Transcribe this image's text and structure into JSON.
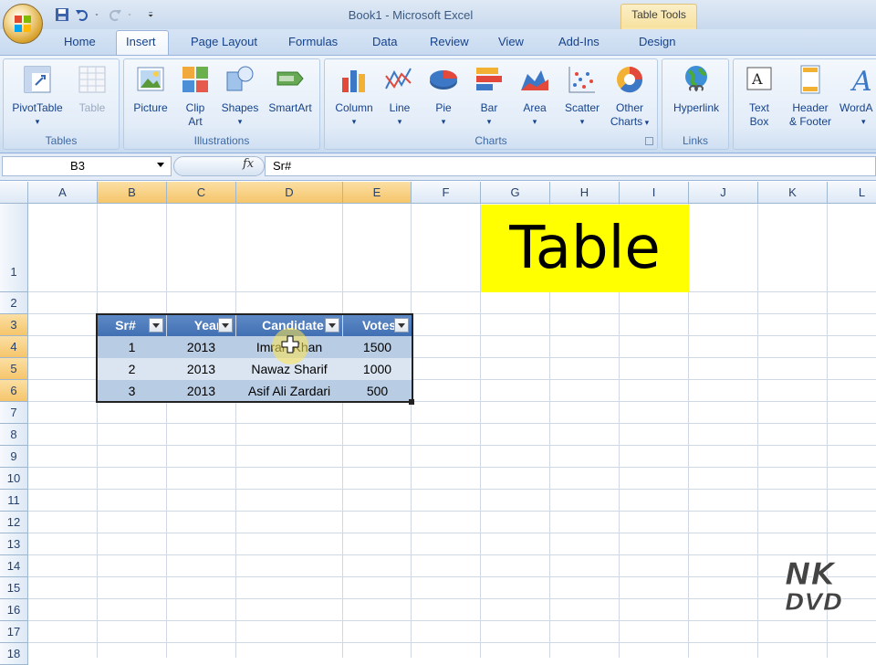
{
  "window": {
    "title": "Book1 - Microsoft Excel",
    "contextual_tab_group": "Table Tools"
  },
  "tabs": [
    "Home",
    "Insert",
    "Page Layout",
    "Formulas",
    "Data",
    "Review",
    "View",
    "Add-Ins",
    "Design"
  ],
  "ribbon": {
    "groups": {
      "tables": "Tables",
      "illustrations": "Illustrations",
      "charts": "Charts",
      "links": "Links"
    },
    "buttons": {
      "pivottable": "PivotTable",
      "table": "Table",
      "picture": "Picture",
      "clipart_1": "Clip",
      "clipart_2": "Art",
      "shapes": "Shapes",
      "smartart": "SmartArt",
      "column": "Column",
      "line": "Line",
      "pie": "Pie",
      "bar": "Bar",
      "area": "Area",
      "scatter": "Scatter",
      "othercharts_1": "Other",
      "othercharts_2": "Charts",
      "hyperlink": "Hyperlink",
      "textbox_1": "Text",
      "textbox_2": "Box",
      "header_1": "Header",
      "header_2": "& Footer",
      "wordart": "WordA"
    }
  },
  "formula_bar": {
    "name_box": "B3",
    "fx": "fx",
    "formula": "Sr#"
  },
  "columns": [
    "A",
    "B",
    "C",
    "D",
    "E",
    "F",
    "G",
    "H",
    "I",
    "J",
    "K",
    "L"
  ],
  "rows": [
    "1",
    "2",
    "3",
    "4",
    "5",
    "6",
    "7",
    "8",
    "9",
    "10",
    "11",
    "12",
    "13",
    "14",
    "15",
    "16",
    "17",
    "18"
  ],
  "table": {
    "headers": [
      "Sr#",
      "Year",
      "Candidate",
      "Votes"
    ],
    "rows": [
      [
        "1",
        "2013",
        "Imran Khan",
        "1500"
      ],
      [
        "2",
        "2013",
        "Nawaz Sharif",
        "1000"
      ],
      [
        "3",
        "2013",
        "Asif Ali Zardari",
        "500"
      ]
    ]
  },
  "banner_text": "Table",
  "watermark": {
    "line1": "NK",
    "line2": "DVD"
  },
  "colors": {
    "table_header": "#4f81bd",
    "row_band_dark": "#b8cce4",
    "row_band_light": "#dbe5f1",
    "banner": "#ffff00",
    "selection": "#f5c56b"
  }
}
